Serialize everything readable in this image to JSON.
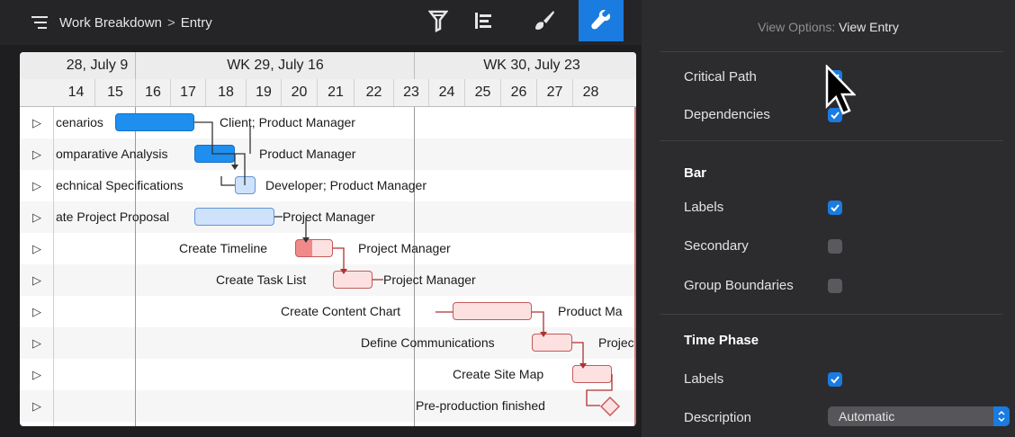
{
  "toolbar": {
    "breadcrumb_root": "Work Breakdown",
    "breadcrumb_separator": ">",
    "breadcrumb_current": "Entry",
    "buttons": [
      "filter-icon",
      "view-icon",
      "style-icon",
      "wrench-icon"
    ]
  },
  "gantt": {
    "weeks": [
      "28, July 9",
      "WK 29, July 16",
      "WK 30, July 23"
    ],
    "days": [
      "14",
      "15",
      "16",
      "17",
      "18",
      "19",
      "20",
      "21",
      "22",
      "23",
      "24",
      "25",
      "26",
      "27",
      "28"
    ],
    "rows": [
      {
        "label": "cenarios",
        "resource": "Client; Product Manager"
      },
      {
        "label": "omparative Analysis",
        "resource": "Product Manager"
      },
      {
        "label": "echnical Specifications",
        "resource": "Developer; Product Manager"
      },
      {
        "label": "ate Project Proposal",
        "resource": "Project Manager"
      },
      {
        "label": "Create Timeline",
        "resource": "Project Manager"
      },
      {
        "label": "Create Task List",
        "resource": "Project Manager"
      },
      {
        "label": "Create Content Chart",
        "resource": "Product Ma"
      },
      {
        "label": "Define Communications",
        "resource": "Projec"
      },
      {
        "label": "Create Site Map",
        "resource": ""
      },
      {
        "label": "Pre-production finished",
        "resource": ""
      }
    ]
  },
  "view_options": {
    "title_prefix": "View Options:",
    "title_name": "View Entry",
    "critical_path": "Critical Path",
    "dependencies": "Dependencies",
    "bar_section": "Bar",
    "bar_labels": "Labels",
    "secondary": "Secondary",
    "group_boundaries": "Group Boundaries",
    "time_phase_section": "Time Phase",
    "tp_labels": "Labels",
    "description": "Description",
    "description_value": "Automatic"
  },
  "colors": {
    "accent": "#1a7be0",
    "bar_blue": "#1e8fef",
    "bar_pink": "#fde1e1",
    "critical": "#c0392b"
  }
}
